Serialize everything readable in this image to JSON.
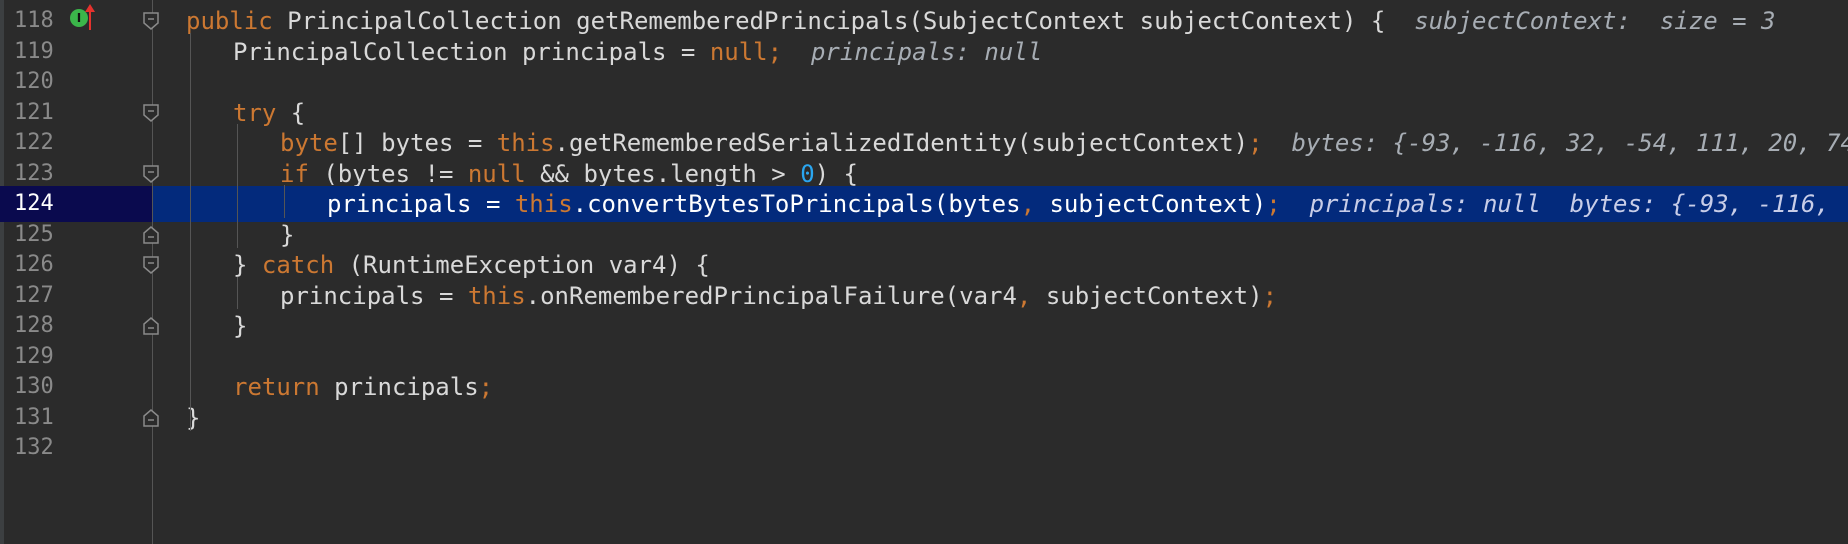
{
  "colors": {
    "background": "#2b2b2b",
    "keyword": "#cc7832",
    "number": "#2aa6f0",
    "current_line": "#032a7c",
    "current_gutter": "#0a0a4e",
    "hint": "#a7adb4"
  },
  "gutter_icons": {
    "implements_icon": "I",
    "override_arrow": "up-arrow-icon"
  },
  "lines": [
    {
      "num": "118",
      "indent": 0,
      "tokens": [
        {
          "t": "public ",
          "c": "kw"
        },
        {
          "t": "PrincipalCollection getRememberedPrincipals(SubjectContext subjectContext) {  ",
          "c": "pl"
        },
        {
          "t": "subjectContext:  size = 3",
          "c": "hint"
        }
      ]
    },
    {
      "num": "119",
      "indent": 1,
      "tokens": [
        {
          "t": "PrincipalCollection principals = ",
          "c": "pl"
        },
        {
          "t": "null;",
          "c": "kw"
        },
        {
          "t": "  ",
          "c": "pl"
        },
        {
          "t": "principals: null",
          "c": "hint"
        }
      ]
    },
    {
      "num": "120",
      "indent": 0,
      "tokens": []
    },
    {
      "num": "121",
      "indent": 1,
      "tokens": [
        {
          "t": "try ",
          "c": "kw"
        },
        {
          "t": "{",
          "c": "pl"
        }
      ]
    },
    {
      "num": "122",
      "indent": 2,
      "tokens": [
        {
          "t": "byte",
          "c": "kw"
        },
        {
          "t": "[] bytes = ",
          "c": "pl"
        },
        {
          "t": "this",
          "c": "kw"
        },
        {
          "t": ".getRememberedSerializedIdentity(subjectContext)",
          "c": "pl"
        },
        {
          "t": ";",
          "c": "kw"
        },
        {
          "t": "  ",
          "c": "pl"
        },
        {
          "t": "bytes: {-93, -116, 32, -54, 111, 20, 74",
          "c": "hint"
        }
      ]
    },
    {
      "num": "123",
      "indent": 2,
      "tokens": [
        {
          "t": "if ",
          "c": "kw"
        },
        {
          "t": "(bytes != ",
          "c": "pl"
        },
        {
          "t": "null ",
          "c": "kw"
        },
        {
          "t": "&& bytes.length > ",
          "c": "pl"
        },
        {
          "t": "0",
          "c": "num"
        },
        {
          "t": ") {",
          "c": "pl"
        }
      ]
    },
    {
      "num": "124",
      "indent": 3,
      "current": true,
      "tokens": [
        {
          "t": "principals = ",
          "c": "pl"
        },
        {
          "t": "this",
          "c": "kw"
        },
        {
          "t": ".convertBytesToPrincipals(bytes",
          "c": "pl"
        },
        {
          "t": ", ",
          "c": "kw"
        },
        {
          "t": "subjectContext)",
          "c": "pl"
        },
        {
          "t": ";",
          "c": "kw"
        },
        {
          "t": "  ",
          "c": "pl"
        },
        {
          "t": "principals: null  bytes: {-93, -116,",
          "c": "hint"
        }
      ]
    },
    {
      "num": "125",
      "indent": 2,
      "tokens": [
        {
          "t": "}",
          "c": "pl"
        }
      ]
    },
    {
      "num": "126",
      "indent": 1,
      "tokens": [
        {
          "t": "} ",
          "c": "pl"
        },
        {
          "t": "catch ",
          "c": "kw"
        },
        {
          "t": "(RuntimeException var4) {",
          "c": "pl"
        }
      ]
    },
    {
      "num": "127",
      "indent": 2,
      "tokens": [
        {
          "t": "principals = ",
          "c": "pl"
        },
        {
          "t": "this",
          "c": "kw"
        },
        {
          "t": ".onRememberedPrincipalFailure(var4",
          "c": "pl"
        },
        {
          "t": ", ",
          "c": "kw"
        },
        {
          "t": "subjectContext)",
          "c": "pl"
        },
        {
          "t": ";",
          "c": "kw"
        }
      ]
    },
    {
      "num": "128",
      "indent": 1,
      "tokens": [
        {
          "t": "}",
          "c": "pl"
        }
      ]
    },
    {
      "num": "129",
      "indent": 0,
      "tokens": []
    },
    {
      "num": "130",
      "indent": 1,
      "tokens": [
        {
          "t": "return ",
          "c": "kw"
        },
        {
          "t": "principals",
          "c": "pl"
        },
        {
          "t": ";",
          "c": "kw"
        }
      ]
    },
    {
      "num": "131",
      "indent": 0,
      "tokens": [
        {
          "t": "}",
          "c": "pl"
        }
      ]
    },
    {
      "num": "132",
      "indent": 0,
      "tokens": []
    }
  ]
}
